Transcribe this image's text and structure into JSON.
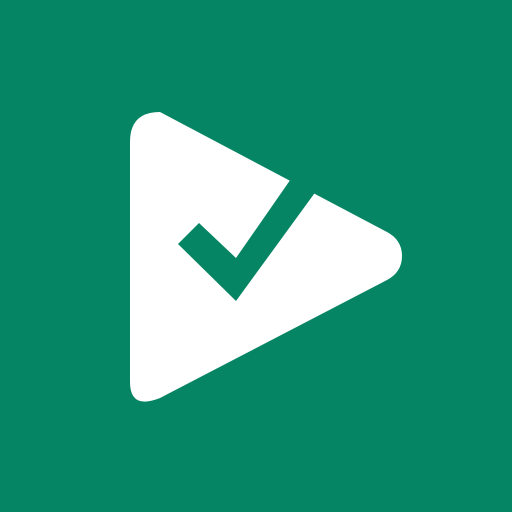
{
  "icon": {
    "name": "play-checkmark-icon",
    "background_color": "#058563",
    "foreground_color": "#FFFFFF"
  }
}
